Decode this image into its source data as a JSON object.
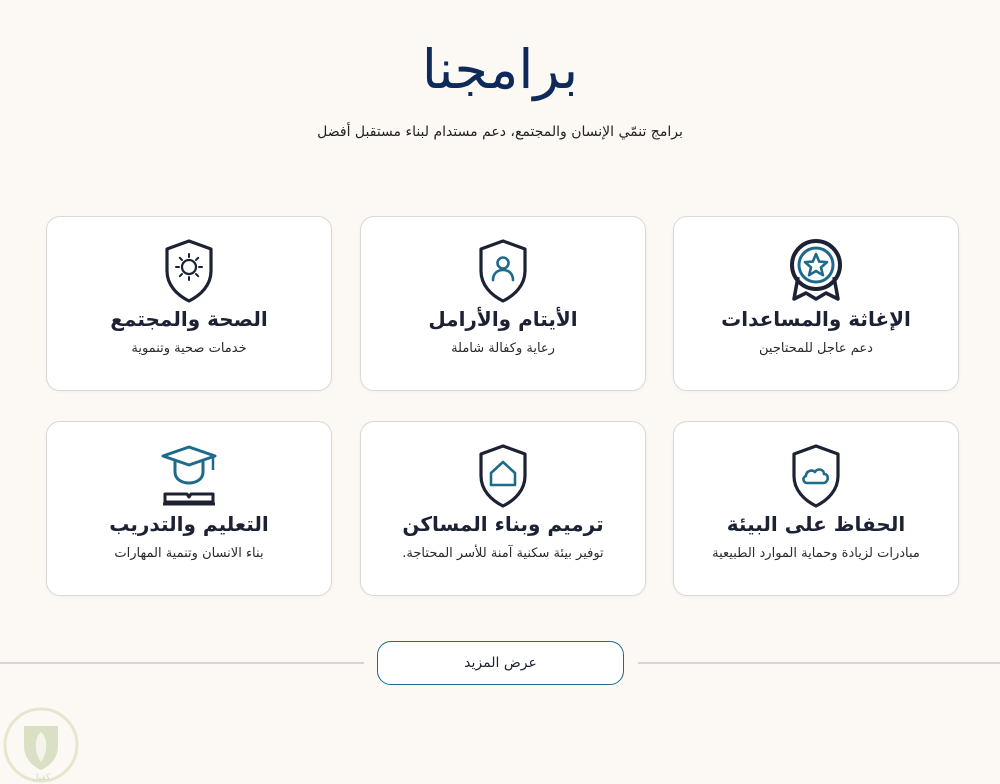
{
  "header": {
    "title": "برامجنا",
    "subtitle": "برامج تنمّي الإنسان والمجتمع، دعم مستدام لبناء مستقبل أفضل"
  },
  "programs": [
    {
      "title": "الإغاثة والمساعدات",
      "description": "دعم عاجل للمحتاجين",
      "icon": "award-star-icon"
    },
    {
      "title": "الأيتام والأرامل",
      "description": "رعاية وكفالة شاملة",
      "icon": "person-shield-icon"
    },
    {
      "title": "الصحة والمجتمع",
      "description": "خدمات صحية وتنموية",
      "icon": "sun-shield-icon"
    },
    {
      "title": "الحفاظ على البيئة",
      "description": "مبادرات لزيادة وحماية الموارد الطبيعية",
      "icon": "cloud-shield-icon"
    },
    {
      "title": "ترميم وبناء المساكن",
      "description": "توفير بيئة سكنية آمنة للأسر  المحتاجة.",
      "icon": "house-shield-icon"
    },
    {
      "title": "التعليم والتدريب",
      "description": "بناء الانسان وتنمية المهارات",
      "icon": "graduation-cap-icon"
    }
  ],
  "actions": {
    "more_label": "عرض المزيد"
  },
  "logo": {
    "text": "كفيل"
  },
  "colors": {
    "background": "#fcf8f4",
    "title": "#0d2a5b",
    "accent": "#1e6a8a",
    "icon_dark": "#1c2233"
  }
}
